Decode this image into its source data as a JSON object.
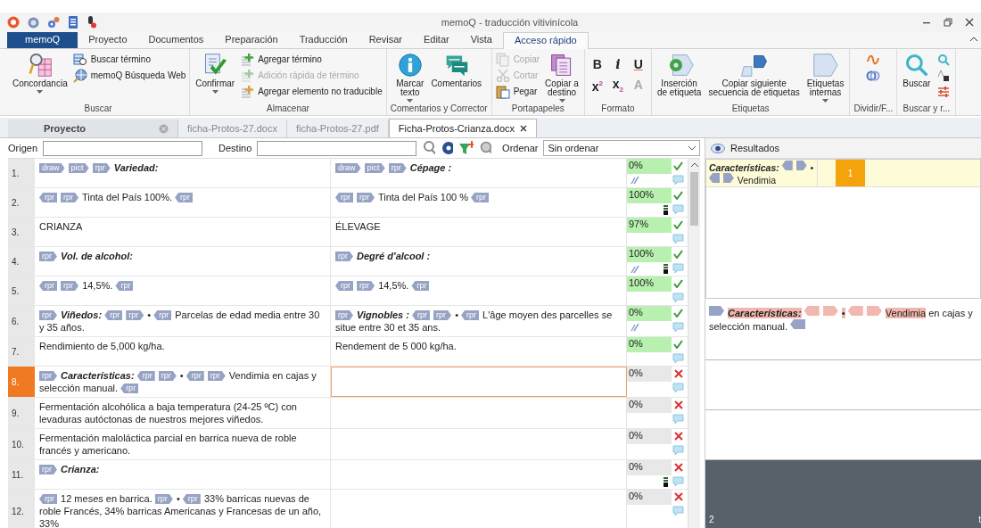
{
  "window": {
    "title": "memoQ - traducción vitivinícola"
  },
  "ribbon": {
    "tabs": [
      {
        "label": "memoQ",
        "kind": "app",
        "selected": false
      },
      {
        "label": "Proyecto",
        "kind": "tab",
        "selected": false
      },
      {
        "label": "Documentos",
        "kind": "tab",
        "selected": false
      },
      {
        "label": "Preparación",
        "kind": "tab",
        "selected": false
      },
      {
        "label": "Traducción",
        "kind": "tab",
        "selected": false
      },
      {
        "label": "Revisar",
        "kind": "tab",
        "selected": false
      },
      {
        "label": "Editar",
        "kind": "tab",
        "selected": false
      },
      {
        "label": "Vista",
        "kind": "tab",
        "selected": false
      },
      {
        "label": "Acceso rápido",
        "kind": "tab",
        "selected": true
      }
    ],
    "groups": [
      {
        "label": "Buscar",
        "items": [
          {
            "kind": "large",
            "label": "Concordancia",
            "dropdown": true,
            "disabled": false
          },
          {
            "kind": "small",
            "label": "Buscar término",
            "disabled": false
          },
          {
            "kind": "small",
            "label": "memoQ Búsqueda Web",
            "disabled": false
          }
        ]
      },
      {
        "label": "Almacenar",
        "items": [
          {
            "kind": "large",
            "label": "Confirmar",
            "dropdown": true,
            "disabled": false
          },
          {
            "kind": "small",
            "label": "Agregar término",
            "disabled": false
          },
          {
            "kind": "small",
            "label": "Adición rápida de término",
            "disabled": true
          },
          {
            "kind": "small",
            "label": "Agregar elemento no traducible",
            "disabled": false
          }
        ]
      },
      {
        "label": "Comentarios y Corrector",
        "items": [
          {
            "kind": "large",
            "label": "Marcar\ntexto",
            "dropdown": true,
            "disabled": false
          },
          {
            "kind": "large",
            "label": "Comentarios",
            "dropdown": false,
            "disabled": false
          }
        ]
      },
      {
        "label": "Portapapeles",
        "items": [
          {
            "kind": "small",
            "label": "Copiar",
            "disabled": true
          },
          {
            "kind": "small",
            "label": "Cortar",
            "disabled": true
          },
          {
            "kind": "small",
            "label": "Pegar",
            "disabled": false
          },
          {
            "kind": "large",
            "label": "Copiar a\ndestino",
            "dropdown": true,
            "disabled": false
          }
        ]
      },
      {
        "label": "Formato",
        "items": [
          {
            "kind": "format",
            "label": "B",
            "disabled": false
          },
          {
            "kind": "format",
            "label": "i",
            "disabled": false
          },
          {
            "kind": "format",
            "label": "U",
            "disabled": false
          },
          {
            "kind": "format",
            "label": "x$^{2}$",
            "disabled": false
          },
          {
            "kind": "format",
            "label": "x$_{2}$",
            "disabled": false
          },
          {
            "kind": "format",
            "label": "A",
            "disabled": true
          }
        ]
      },
      {
        "label": "Etiquetas",
        "items": [
          {
            "kind": "large",
            "label": "Inserción\nde etiqueta",
            "dropdown": false,
            "disabled": false
          },
          {
            "kind": "large",
            "label": "Copiar siguiente\nsecuencia de etiquetas",
            "dropdown": false,
            "disabled": false
          },
          {
            "kind": "large",
            "label": "Etiquetas\ninternas",
            "dropdown": true,
            "disabled": false
          }
        ]
      },
      {
        "label": "Dividir/F...",
        "items": [
          {
            "kind": "icon",
            "disabled": false
          },
          {
            "kind": "icon",
            "disabled": false
          }
        ]
      },
      {
        "label": "Buscar y r...",
        "items": [
          {
            "kind": "large",
            "label": "Buscar",
            "dropdown": false,
            "disabled": false
          },
          {
            "kind": "icon",
            "disabled": false
          },
          {
            "kind": "icon",
            "disabled": false
          },
          {
            "kind": "icon",
            "disabled": false
          }
        ]
      }
    ]
  },
  "document_tabs": [
    {
      "label": "Proyecto",
      "kind": "project",
      "selected": false
    },
    {
      "label": "ficha-Protos-27.docx",
      "kind": "document",
      "selected": false
    },
    {
      "label": "ficha-Protos-27.pdf",
      "kind": "document",
      "selected": false
    },
    {
      "label": "Ficha-Protos-Crianza.docx",
      "kind": "document",
      "selected": true
    }
  ],
  "filter_bar": {
    "source_label": "Origen",
    "target_label": "Destino",
    "sort_label": "Ordenar",
    "sort_value": "Sin ordenar"
  },
  "rows": [
    {
      "number": "1.",
      "source": [
        {
          "kind": "open-tag",
          "text": "draw"
        },
        {
          "kind": "open-tag",
          "text": "pict"
        },
        {
          "kind": "open-tag",
          "text": "rpr"
        },
        {
          "kind": "bold",
          "text": "Variedad:"
        }
      ],
      "target": [
        {
          "kind": "open-tag",
          "text": "draw"
        },
        {
          "kind": "open-tag",
          "text": "pict"
        },
        {
          "kind": "open-tag",
          "text": "rpr"
        },
        {
          "kind": "bold",
          "text": "Cépage :"
        }
      ],
      "match": "0%",
      "confirmed": true,
      "selected": false,
      "pen_mark": true,
      "bar_mark": false
    },
    {
      "number": "2.",
      "source": [
        {
          "kind": "close-tag",
          "text": "rpr"
        },
        {
          "kind": "open-tag",
          "text": "rpr"
        },
        {
          "kind": "text",
          "text": "Tinta del País 100%."
        },
        {
          "kind": "close-tag",
          "text": "rpr"
        }
      ],
      "target": [
        {
          "kind": "close-tag",
          "text": "rpr"
        },
        {
          "kind": "open-tag",
          "text": "rpr"
        },
        {
          "kind": "text",
          "text": "Tinta del País 100 %"
        },
        {
          "kind": "close-tag",
          "text": "rpr"
        }
      ],
      "match": "100%",
      "confirmed": true,
      "selected": false,
      "pen_mark": false,
      "bar_mark": true
    },
    {
      "number": "3.",
      "source": [
        {
          "kind": "text",
          "text": "CRIANZA"
        }
      ],
      "target": [
        {
          "kind": "text",
          "text": "ÉLEVAGE"
        }
      ],
      "match": "97%",
      "confirmed": true,
      "selected": false,
      "pen_mark": false,
      "bar_mark": false
    },
    {
      "number": "4.",
      "source": [
        {
          "kind": "open-tag",
          "text": "rpr"
        },
        {
          "kind": "bold",
          "text": "Vol. de alcohol:"
        }
      ],
      "target": [
        {
          "kind": "open-tag",
          "text": "rpr"
        },
        {
          "kind": "bold",
          "text": "Degré d'alcool :"
        }
      ],
      "match": "100%",
      "confirmed": true,
      "selected": false,
      "pen_mark": true,
      "bar_mark": true
    },
    {
      "number": "5.",
      "source": [
        {
          "kind": "close-tag",
          "text": "rpr"
        },
        {
          "kind": "open-tag",
          "text": "rpr"
        },
        {
          "kind": "text",
          "text": "14,5%."
        },
        {
          "kind": "close-tag",
          "text": "rpr"
        }
      ],
      "target": [
        {
          "kind": "close-tag",
          "text": "rpr"
        },
        {
          "kind": "open-tag",
          "text": "rpr"
        },
        {
          "kind": "text",
          "text": "14,5%."
        },
        {
          "kind": "close-tag",
          "text": "rpr"
        }
      ],
      "match": "100%",
      "confirmed": true,
      "selected": false,
      "pen_mark": false,
      "bar_mark": false
    },
    {
      "number": "6.",
      "source": [
        {
          "kind": "open-tag",
          "text": "rpr"
        },
        {
          "kind": "bold",
          "text": "Viñedos:"
        },
        {
          "kind": "close-tag",
          "text": "rpr"
        },
        {
          "kind": "open-tag",
          "text": "rpr"
        },
        {
          "kind": "text",
          "text": "•"
        },
        {
          "kind": "close-tag",
          "text": "rpr"
        },
        {
          "kind": "text",
          "text": "Parcelas de edad media entre 30 y 35 años."
        }
      ],
      "target": [
        {
          "kind": "open-tag",
          "text": "rpr"
        },
        {
          "kind": "bold",
          "text": "Vignobles :"
        },
        {
          "kind": "close-tag",
          "text": "rpr"
        },
        {
          "kind": "open-tag",
          "text": "rpr"
        },
        {
          "kind": "text",
          "text": "•"
        },
        {
          "kind": "close-tag",
          "text": "rpr"
        },
        {
          "kind": "text",
          "text": "L'âge moyen des parcelles se situe entre 30 et 35 ans."
        }
      ],
      "match": "0%",
      "confirmed": true,
      "selected": false,
      "pen_mark": true,
      "bar_mark": false
    },
    {
      "number": "7.",
      "source": [
        {
          "kind": "text",
          "text": "Rendimiento de 5,000 kg/ha."
        }
      ],
      "target": [
        {
          "kind": "text",
          "text": "Rendement de 5 000 kg/ha."
        }
      ],
      "match": "0%",
      "confirmed": true,
      "selected": false,
      "pen_mark": false,
      "bar_mark": false
    },
    {
      "number": "8.",
      "source": [
        {
          "kind": "open-tag",
          "text": "rpr"
        },
        {
          "kind": "bold",
          "text": "Características:"
        },
        {
          "kind": "close-tag",
          "text": "rpr"
        },
        {
          "kind": "open-tag",
          "text": "rpr"
        },
        {
          "kind": "text",
          "text": "•"
        },
        {
          "kind": "close-tag",
          "text": "rpr"
        },
        {
          "kind": "open-tag",
          "text": "rpr"
        },
        {
          "kind": "text",
          "text": "Vendimia en cajas y selección manual."
        },
        {
          "kind": "close-tag",
          "text": "rpr"
        }
      ],
      "target": [],
      "match": "0%",
      "confirmed": false,
      "selected": true,
      "pen_mark": false,
      "bar_mark": false
    },
    {
      "number": "9.",
      "source": [
        {
          "kind": "text",
          "text": "Fermentación alcohólica a baja temperatura (24-25 ºC) con levaduras autóctonas de nuestros mejores viñedos."
        }
      ],
      "target": [],
      "match": "0%",
      "confirmed": false,
      "selected": false,
      "pen_mark": false,
      "bar_mark": false
    },
    {
      "number": "10.",
      "source": [
        {
          "kind": "text",
          "text": "Fermentación maloláctica parcial en barrica nueva de roble francés y americano."
        }
      ],
      "target": [],
      "match": "0%",
      "confirmed": false,
      "selected": false,
      "pen_mark": false,
      "bar_mark": false
    },
    {
      "number": "11.",
      "source": [
        {
          "kind": "open-tag",
          "text": "rpr"
        },
        {
          "kind": "bold",
          "text": "Crianza:"
        }
      ],
      "target": [],
      "match": "0%",
      "confirmed": false,
      "selected": false,
      "pen_mark": false,
      "bar_mark": true
    },
    {
      "number": "12.",
      "source": [
        {
          "kind": "close-tag",
          "text": "rpr"
        },
        {
          "kind": "text",
          "text": "12 meses en barrica."
        },
        {
          "kind": "open-tag",
          "text": "rpr"
        },
        {
          "kind": "text",
          "text": "•"
        },
        {
          "kind": "close-tag",
          "text": "rpr"
        },
        {
          "kind": "text",
          "text": "33% barricas nuevas de roble Francés, 34% barricas Americanas y Francesas de un año, 33%"
        }
      ],
      "target": [],
      "match": "0%",
      "confirmed": false,
      "selected": false,
      "pen_mark": false,
      "bar_mark": false
    }
  ],
  "results": {
    "title": "Resultados",
    "items": [
      {
        "parts": [
          {
            "kind": "bold",
            "text": "Características:"
          },
          {
            "kind": "close-tag"
          },
          {
            "kind": "open-tag"
          },
          {
            "kind": "text",
            "text": "•"
          },
          {
            "kind": "close-tag"
          },
          {
            "kind": "open-tag"
          },
          {
            "kind": "text",
            "text": "Vendimia"
          }
        ],
        "number": "1"
      }
    ],
    "preview": [
      {
        "kind": "open-tag",
        "highlight": false
      },
      {
        "kind": "bold",
        "text": "Características:",
        "highlight": true
      },
      {
        "kind": "close-tag",
        "highlight": true
      },
      {
        "kind": "open-tag",
        "highlight": true
      },
      {
        "kind": "text",
        "text": "•",
        "highlight": true
      },
      {
        "kind": "close-tag",
        "highlight": true
      },
      {
        "kind": "open-tag",
        "highlight": true
      },
      {
        "kind": "text",
        "text": "Vendimia",
        "highlight": true
      },
      {
        "kind": "text",
        "text": " en cajas y selección manual.",
        "highlight": false
      },
      {
        "kind": "close-tag",
        "highlight": false
      }
    ],
    "footer": "2",
    "footer_right": "t"
  }
}
